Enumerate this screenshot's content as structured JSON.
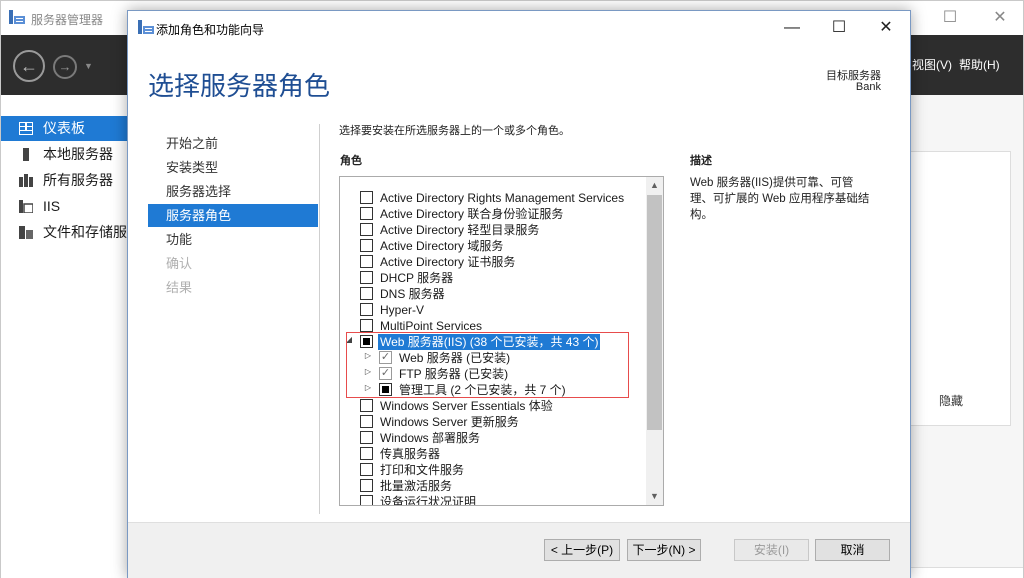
{
  "server_manager": {
    "title": "服务器管理器",
    "menu": {
      "view": "视图(V)",
      "help": "帮助(H)"
    },
    "nav": [
      {
        "label": "仪表板",
        "icon": "dashboard-icon",
        "active": true
      },
      {
        "label": "本地服务器",
        "icon": "local-server-icon",
        "active": false
      },
      {
        "label": "所有服务器",
        "icon": "all-servers-icon",
        "active": false
      },
      {
        "label": "IIS",
        "icon": "iis-icon",
        "active": false
      },
      {
        "label": "文件和存储服",
        "icon": "file-storage-icon",
        "active": false
      }
    ],
    "hide_label": "隐藏",
    "window_controls": {
      "minimize": "—",
      "maximize": "☐",
      "close": "✕"
    }
  },
  "wizard": {
    "title": "添加角色和功能向导",
    "heading": "选择服务器角色",
    "target_label": "目标服务器",
    "target_value": "Bank",
    "window_controls": {
      "minimize": "—",
      "maximize": "☐",
      "close": "✕"
    },
    "steps": [
      {
        "label": "开始之前",
        "state": "normal"
      },
      {
        "label": "安装类型",
        "state": "normal"
      },
      {
        "label": "服务器选择",
        "state": "normal"
      },
      {
        "label": "服务器角色",
        "state": "active"
      },
      {
        "label": "功能",
        "state": "normal"
      },
      {
        "label": "确认",
        "state": "disabled"
      },
      {
        "label": "结果",
        "state": "disabled"
      }
    ],
    "instructions": "选择要安装在所选服务器上的一个或多个角色。",
    "roles_label": "角色",
    "description_label": "描述",
    "description_text": "Web 服务器(IIS)提供可靠、可管理、可扩展的 Web 应用程序基础结构。",
    "roles": [
      {
        "label": "Active Directory Rights Management Services",
        "level": 0,
        "state": "unchecked",
        "expander": ""
      },
      {
        "label": "Active Directory 联合身份验证服务",
        "level": 0,
        "state": "unchecked",
        "expander": ""
      },
      {
        "label": "Active Directory 轻型目录服务",
        "level": 0,
        "state": "unchecked",
        "expander": ""
      },
      {
        "label": "Active Directory 域服务",
        "level": 0,
        "state": "unchecked",
        "expander": ""
      },
      {
        "label": "Active Directory 证书服务",
        "level": 0,
        "state": "unchecked",
        "expander": ""
      },
      {
        "label": "DHCP 服务器",
        "level": 0,
        "state": "unchecked",
        "expander": ""
      },
      {
        "label": "DNS 服务器",
        "level": 0,
        "state": "unchecked",
        "expander": ""
      },
      {
        "label": "Hyper-V",
        "level": 0,
        "state": "unchecked",
        "expander": ""
      },
      {
        "label": "MultiPoint Services",
        "level": 0,
        "state": "unchecked",
        "expander": ""
      },
      {
        "label": "Web 服务器(IIS) (38 个已安装，共 43 个)",
        "level": 0,
        "state": "indeterminate",
        "expander": "expanded",
        "selected": true
      },
      {
        "label": "Web 服务器 (已安装)",
        "level": 1,
        "state": "checked",
        "expander": "collapsed"
      },
      {
        "label": "FTP 服务器 (已安装)",
        "level": 1,
        "state": "checked",
        "expander": "collapsed"
      },
      {
        "label": "管理工具 (2 个已安装，共 7 个)",
        "level": 1,
        "state": "indeterminate",
        "expander": "collapsed"
      },
      {
        "label": "Windows Server Essentials 体验",
        "level": 0,
        "state": "unchecked",
        "expander": ""
      },
      {
        "label": "Windows Server 更新服务",
        "level": 0,
        "state": "unchecked",
        "expander": ""
      },
      {
        "label": "Windows 部署服务",
        "level": 0,
        "state": "unchecked",
        "expander": ""
      },
      {
        "label": "传真服务器",
        "level": 0,
        "state": "unchecked",
        "expander": ""
      },
      {
        "label": "打印和文件服务",
        "level": 0,
        "state": "unchecked",
        "expander": ""
      },
      {
        "label": "批量激活服务",
        "level": 0,
        "state": "unchecked",
        "expander": ""
      },
      {
        "label": "设备运行状况证明",
        "level": 0,
        "state": "unchecked",
        "expander": ""
      }
    ],
    "buttons": {
      "previous": "< 上一步(P)",
      "next": "下一步(N) >",
      "install": "安装(I)",
      "cancel": "取消"
    }
  },
  "colors": {
    "accent": "#1f7ad4",
    "heading": "#1f4e93",
    "highlight_box": "#e74c4c",
    "header_bar": "#2d2d2d"
  }
}
